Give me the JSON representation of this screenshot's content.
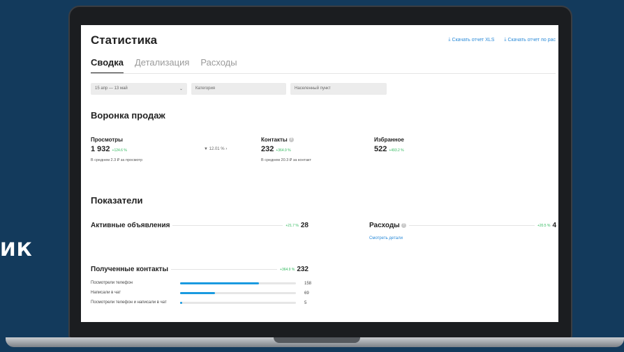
{
  "side_text": "ИК",
  "app": {
    "title": "Статистика",
    "downloads": [
      "Скачать отчет XLS",
      "Скачать отчет по рас"
    ],
    "tabs": [
      {
        "label": "Сводка",
        "active": true
      },
      {
        "label": "Детализация",
        "active": false
      },
      {
        "label": "Расходы",
        "active": false
      }
    ],
    "filters": {
      "date": "15 апр — 13 май",
      "category_placeholder": "Категория",
      "city_placeholder": "Населенный пункт"
    }
  },
  "funnel": {
    "title": "Воронка продаж",
    "views": {
      "label": "Просмотры",
      "value": "1 932",
      "delta": "+124.6 %",
      "sub": "В среднем 2.3 ₽ за просмотр"
    },
    "conversion": "12.01 %",
    "contacts": {
      "label": "Контакты",
      "value": "232",
      "delta": "+364.9 %",
      "sub": "В среднем 20.3 ₽ за контакт"
    },
    "favorites": {
      "label": "Избранное",
      "value": "522",
      "delta": "+493.2 %"
    }
  },
  "indicators": {
    "title": "Показатели",
    "active_ads": {
      "label": "Активные объявления",
      "delta": "+21.7 %",
      "value": "28"
    },
    "expenses": {
      "label": "Расходы",
      "delta": "+20.5 %",
      "value": "4",
      "link": "Смотреть детали"
    },
    "received_contacts": {
      "label": "Полученные контакты",
      "delta": "+364.9 %",
      "value": "232"
    },
    "bars": [
      {
        "label": "Посмотрели телефон",
        "value": "158",
        "fraction": 0.68
      },
      {
        "label": "Написали в чат",
        "value": "69",
        "fraction": 0.3
      },
      {
        "label": "Посмотрели телефон и написали в чат",
        "value": "5",
        "fraction": 0.02
      }
    ]
  },
  "colors": {
    "background": "#133a5c",
    "accent": "#1a9ae0",
    "positive": "#2fb85c"
  }
}
